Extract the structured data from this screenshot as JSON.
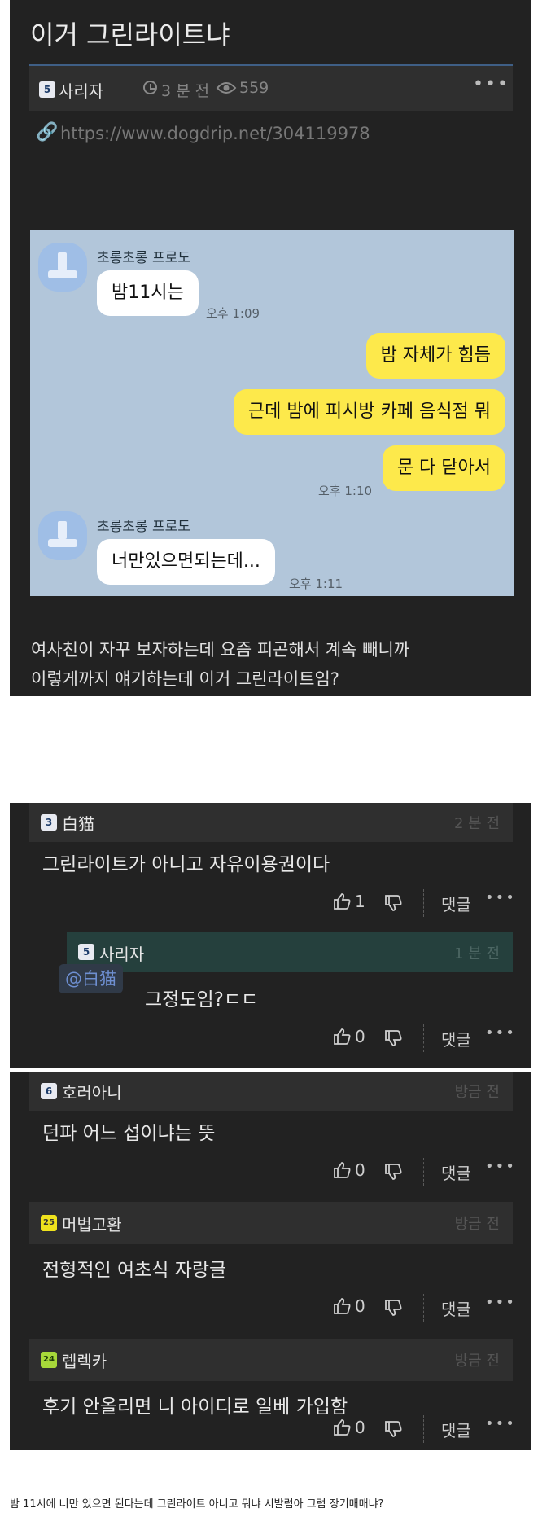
{
  "post": {
    "title": "이거 그린라이트냐",
    "author_level": "5",
    "author": "사리자",
    "time": "3 분 전",
    "views": "559",
    "link": "https://www.dogdrip.net/304119978",
    "body_line1": "여사친이 자꾸 보자하는데 요즘 피곤해서 계속 빼니까",
    "body_line2": "이렇게까지 얘기하는데 이거 그린라이트임?"
  },
  "chat": {
    "sender1": "초롱초롱 프로도",
    "msg1": "밤11시는",
    "time1": "오후 1:09",
    "my1": "밤 자체가 힘듬",
    "my2": "근데 밤에 피시방 카페 음식점 뭐",
    "my3": "문 다 닫아서",
    "time2": "오후 1:10",
    "sender2": "초롱초롱 프로도",
    "msg2": "너만있으면되는데...",
    "time3": "오후 1:11"
  },
  "comments": [
    {
      "level": "3",
      "author": "白猫",
      "time": "2 분 전",
      "text": "그린라이트가 아니고 자유이용권이다",
      "likes": "1",
      "reply_label": "댓글"
    },
    {
      "level": "5",
      "author": "사리자",
      "time": "1 분 전",
      "mention": "@白猫",
      "text": "그정도임?ㄷㄷ",
      "likes": "0",
      "reply_label": "댓글"
    },
    {
      "level": "6",
      "author": "호러아니",
      "time": "방금 전",
      "text": "던파 어느 섭이냐는 뜻",
      "likes": "0",
      "reply_label": "댓글"
    },
    {
      "level": "25",
      "author": "머법고환",
      "time": "방금 전",
      "text": "전형적인 여초식 자랑글",
      "likes": "0",
      "reply_label": "댓글"
    },
    {
      "level": "24",
      "author": "렙렉카",
      "time": "방금 전",
      "text": "후기 안올리면 니 아이디로 일베 가입함",
      "likes": "0",
      "reply_label": "댓글"
    }
  ],
  "caption": "밤 11시에 너만 있으면 된다는데 그린라이트 아니고 뭐냐 시발럼아 그럼 장기매매냐?",
  "icons": [
    "clock-icon",
    "eye-icon",
    "link-icon",
    "more-icon",
    "thumbs-up-icon",
    "thumbs-down-icon"
  ],
  "colors": {
    "panel": "#222222",
    "kakao_bg": "#b2c6da",
    "my_bubble": "#fde94b",
    "reply_bg": "#25403d",
    "accent": "#3f5f86"
  }
}
